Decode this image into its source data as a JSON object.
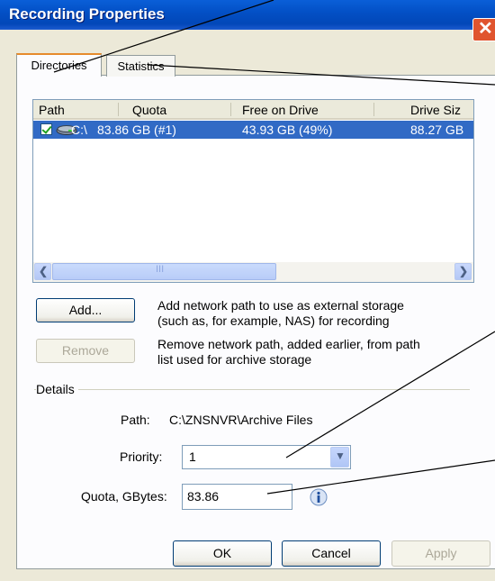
{
  "window": {
    "title": "Recording Properties"
  },
  "tabs": [
    {
      "label": "Directories",
      "active": true
    },
    {
      "label": "Statistics",
      "active": false
    }
  ],
  "table": {
    "columns": [
      "Path",
      "Quota",
      "Free on Drive",
      "Drive Siz"
    ],
    "rows": [
      {
        "checked": true,
        "icon": "drive-icon",
        "path": "C:\\",
        "quota": "83.86 GB (#1)",
        "free": "43.93 GB (49%)",
        "size": "88.27 GB"
      }
    ],
    "scroll_grip": "III"
  },
  "buttons": {
    "add": "Add...",
    "remove": "Remove",
    "ok": "OK",
    "cancel": "Cancel",
    "apply": "Apply"
  },
  "descriptions": {
    "add_line1": "Add network path to use as external storage",
    "add_line2": "(such as, for example, NAS) for recording",
    "remove_line1": "Remove network path, added earlier, from path",
    "remove_line2": "list used for archive storage"
  },
  "details": {
    "group_label": "Details",
    "path_label": "Path:",
    "path_value": "C:\\ZNSNVR\\Archive Files",
    "priority_label": "Priority:",
    "priority_value": "1",
    "quota_label": "Quota, GBytes:",
    "quota_value": "83.86"
  },
  "colors": {
    "titlebar": "#0350c6",
    "selection": "#316ac5",
    "tab_highlight": "#e68b2c",
    "dialog_bg": "#ece9d8"
  }
}
